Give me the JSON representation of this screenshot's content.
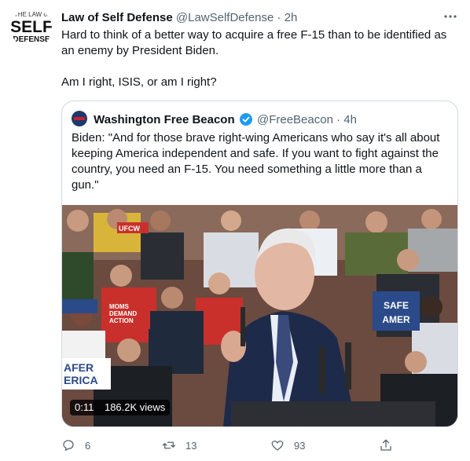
{
  "tweet": {
    "author_name": "Law of Self Defense",
    "handle": "@LawSelfDefense",
    "separator": "·",
    "time": "2h",
    "avatar_text_top": "THE LAW of",
    "avatar_text_main": "SELF",
    "avatar_text_bottom": "DEFENSE",
    "text_line1": "Hard to think of a better way to acquire a free F-15 than to be identified as an enemy by President Biden.",
    "text_line2": "Am I right, ISIS, or am I right?"
  },
  "quoted": {
    "author_name": "Washington Free Beacon",
    "handle": "@FreeBeacon",
    "separator": "·",
    "time": "4h",
    "text": "Biden: \"And for those brave right-wing Americans who say it's all about keeping America independent and safe. If you want to fight against the country, you need an F-15. You need something a little more than a gun.\"",
    "video": {
      "duration": "0:11",
      "views": "186.2K views",
      "sign_moms": "MOMS",
      "sign_demand": "DEMAND",
      "sign_action": "ACTION",
      "sign_safe1": "SAFE",
      "sign_america1": "AMER",
      "sign_safer": "AFER",
      "sign_erica": "ERICA",
      "sign_uaw": "UFCW"
    }
  },
  "actions": {
    "replies": "6",
    "retweets": "13",
    "likes": "93"
  },
  "colors": {
    "text": "#0f1419",
    "secondary": "#536471",
    "border": "#cfd9de",
    "verified": "#1d9bf0"
  },
  "icons": [
    "more-icon",
    "verified-icon",
    "reply-icon",
    "retweet-icon",
    "like-icon",
    "share-icon"
  ]
}
